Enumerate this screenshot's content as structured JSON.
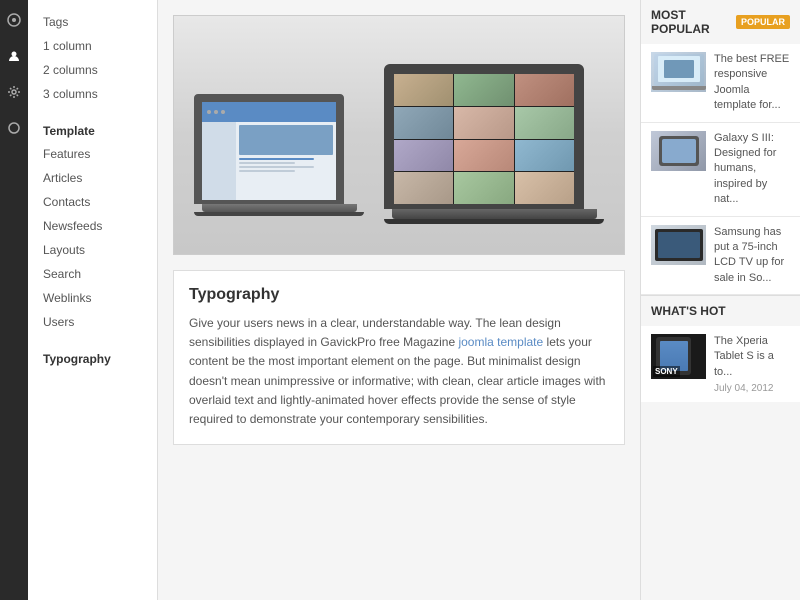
{
  "sidebar_icons": {
    "icons": [
      "⊕",
      "☺",
      "⚙",
      "○"
    ]
  },
  "nav": {
    "sections": [
      {
        "title": "",
        "items": [
          "Tags",
          "1 column",
          "2 columns",
          "3 columns"
        ]
      },
      {
        "title": "Template",
        "items": [
          "Features",
          "Articles",
          "Contacts",
          "Newsfeeds",
          "Layouts",
          "Search",
          "Weblinks",
          "Users"
        ]
      },
      {
        "title": "Typography",
        "items": []
      }
    ]
  },
  "main": {
    "hero_alt": "Laptop showcase image",
    "typography_section_title": "Typography",
    "typography_text_part1": "Give your users news in a clear, understandable way. The lean design sensibilities displayed in GavickPro free Magazine ",
    "typography_link_text": "joomla template",
    "typography_text_part2": " lets your content be the most important element on the page. But minimalist design doesn't mean unimpressive or informative; with clean, clear article images with overlaid text and lightly-animated hover effects provide the sense of style required to demonstrate your contemporary sensibilities."
  },
  "right_sidebar": {
    "most_popular_title": "MOST POPULAR",
    "popular_badge": "POPULAR",
    "articles": [
      {
        "text": "The best FREE responsive Joomla template for..."
      },
      {
        "text": "Galaxy S III: Designed for humans, inspired by nat..."
      },
      {
        "text": "Samsung has put a 75-inch LCD TV up for sale in So..."
      }
    ],
    "whats_hot_title": "WHAT'S HOT",
    "hot_articles": [
      {
        "title": "The Xperia Tablet S is a to...",
        "date": "July 04, 2012",
        "label": "SONY"
      }
    ]
  }
}
